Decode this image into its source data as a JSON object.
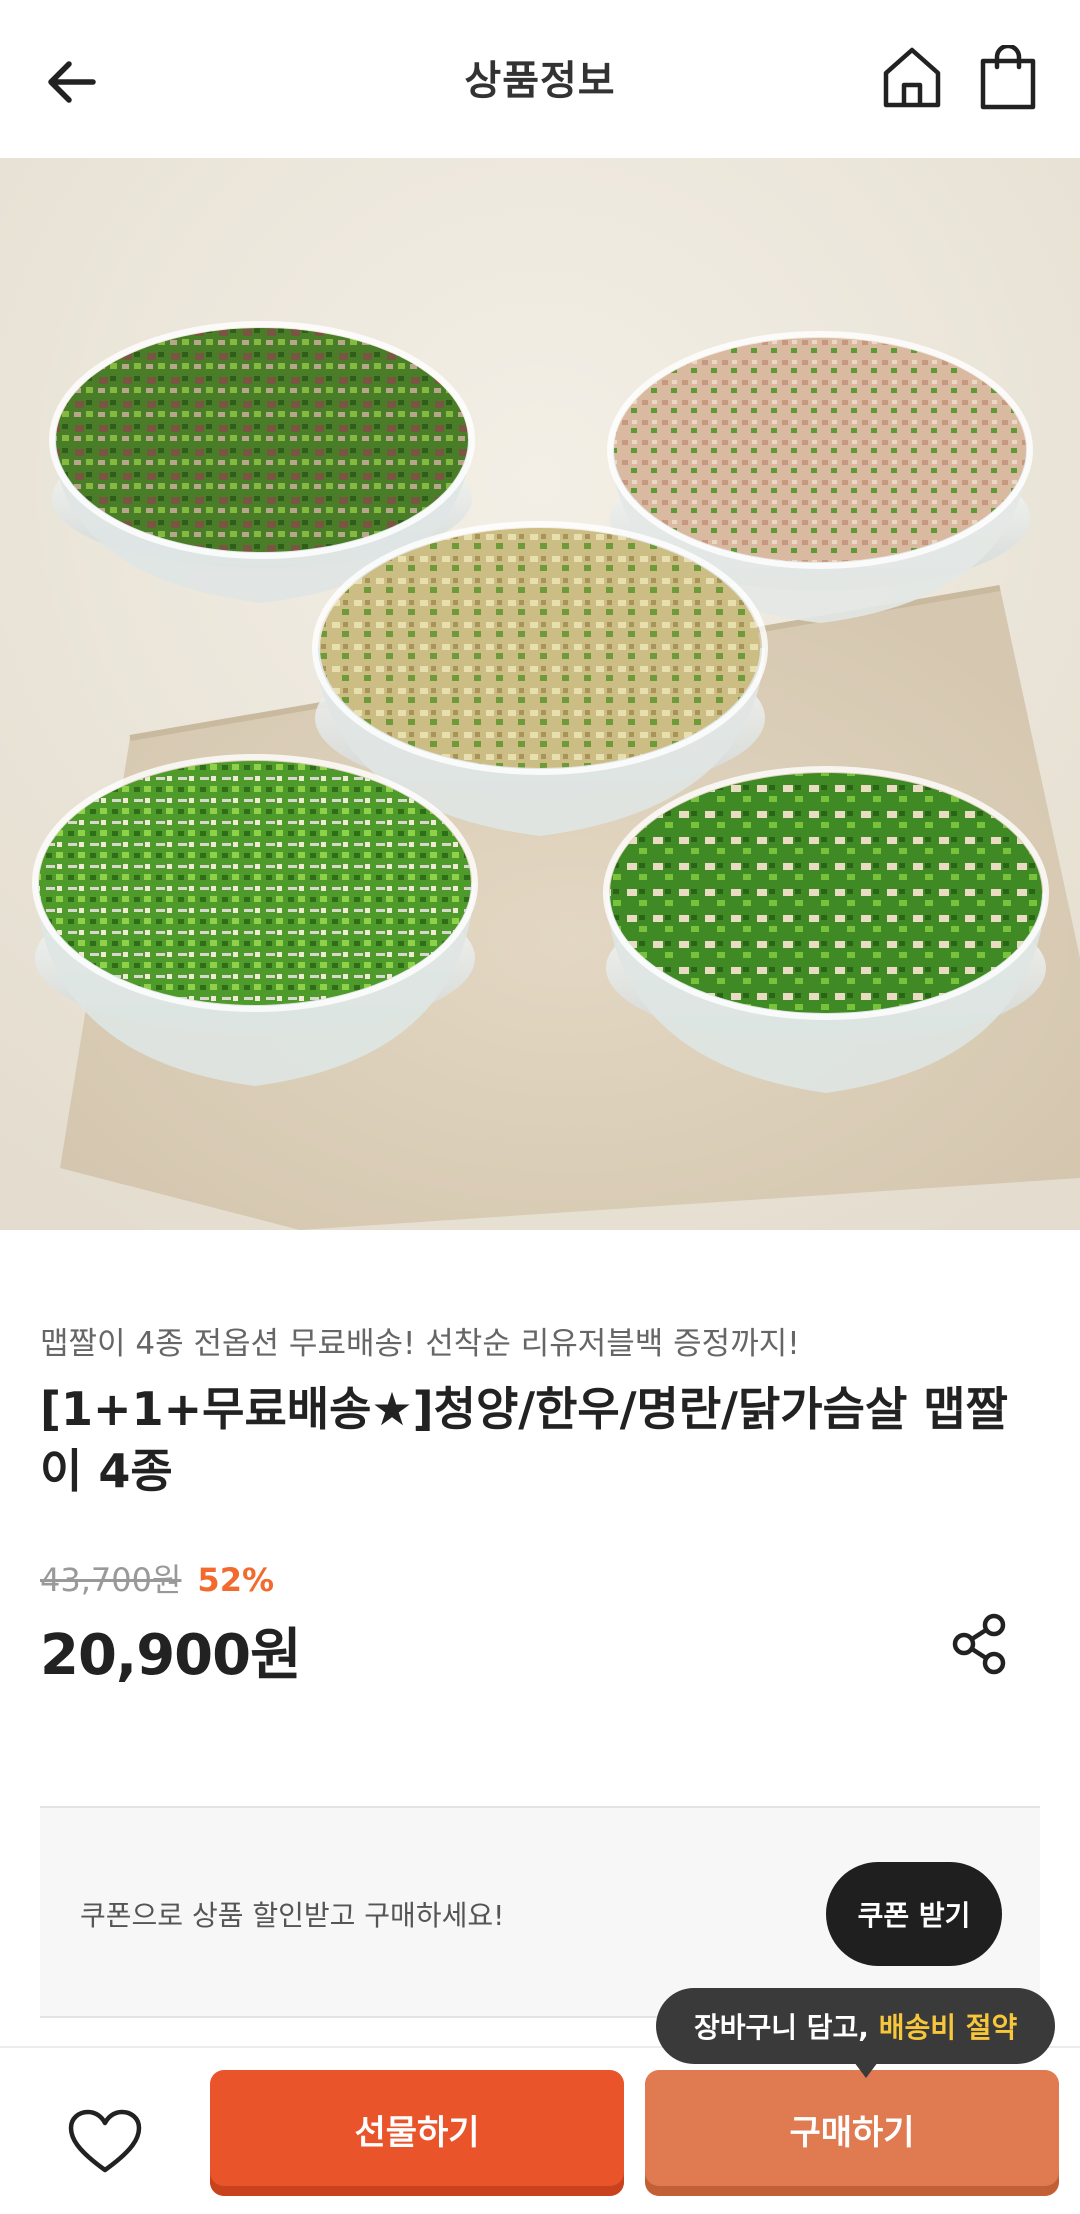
{
  "header": {
    "title": "상품정보"
  },
  "icons": {
    "back": "arrow-left-icon",
    "home": "home-icon",
    "cart": "shopping-bag-icon",
    "share": "share-icon",
    "wish": "heart-icon"
  },
  "product": {
    "subtitle": "맵짤이 4종 전옵션 무료배송! 선착순 리유저블백 증정까지!",
    "name": "[1+1+무료배송★]청양/한우/명란/닭가슴살 맵짤이 4종",
    "original_price": "43,700원",
    "discount": "52%",
    "sale_price": "20,900원"
  },
  "coupon": {
    "text": "쿠폰으로 상품 할인받고 구매하세요!",
    "button": "쿠폰 받기"
  },
  "bottom_bar": {
    "gift_label": "선물하기",
    "buy_label": "구매하기",
    "tooltip_prefix": "장바구니 담고, ",
    "tooltip_highlight": "배송비 절약"
  },
  "colors": {
    "accent": "#e9542a",
    "buy": "#e07a50",
    "discount": "#f26a2d",
    "highlight": "#f7c63a"
  }
}
